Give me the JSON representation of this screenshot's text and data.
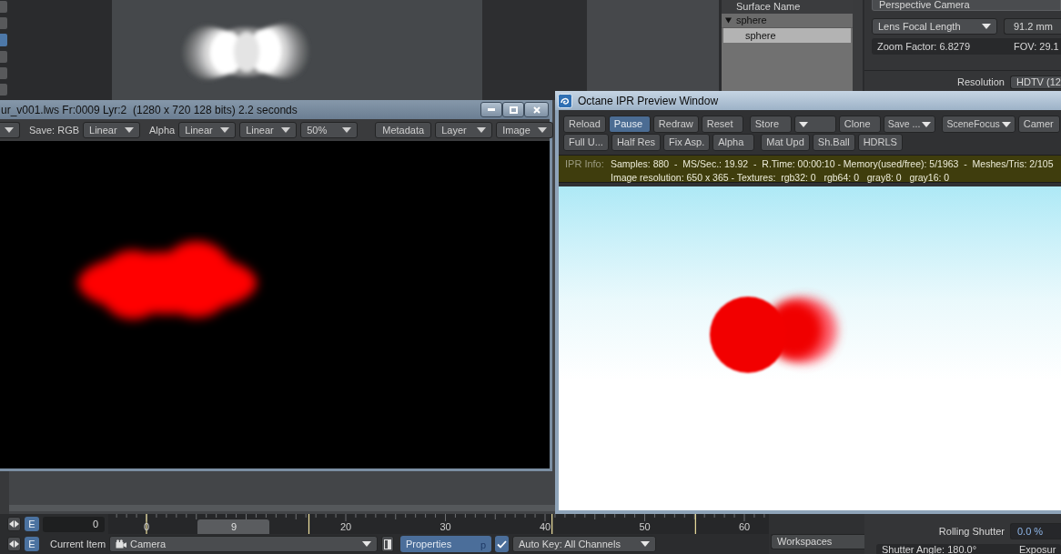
{
  "tool_strip": [
    {
      "selected": false
    },
    {
      "selected": false
    },
    {
      "selected": true
    },
    {
      "selected": false
    },
    {
      "selected": false
    },
    {
      "selected": false
    }
  ],
  "surface_panel": {
    "header": "Surface Name",
    "tree": [
      {
        "label": "sphere",
        "expanded": true,
        "selected": false,
        "children": [
          {
            "label": "sphere",
            "selected": true
          }
        ]
      }
    ]
  },
  "camera_panel": {
    "camera_type": "Perspective Camera",
    "lens_mode": "Lens Focal Length",
    "focal_length": "91.2 mm",
    "zoom_factor": "Zoom Factor: 6.8279",
    "fov": "FOV: 29.1",
    "resolution_label": "Resolution",
    "resolution": "HDTV (12",
    "rolling_shutter_label": "Rolling Shutter",
    "rolling_shutter": "0.0 %",
    "shutter_angle": "Shutter Angle: 180.0°",
    "exposure": "Exposur"
  },
  "render_window": {
    "title": "ur_v001.lws Fr:0009 Lyr:2  (1280 x 720 128 bits) 2.2 seconds",
    "toolbar": [
      {
        "kind": "dropdown"
      },
      {
        "kind": "label",
        "text": "Save: RGB"
      },
      {
        "kind": "dropdown",
        "label": "Linear"
      },
      {
        "kind": "label",
        "text": "Alpha"
      },
      {
        "kind": "dropdown",
        "label": "Linear"
      },
      {
        "kind": "dropdown",
        "label": "Linear"
      },
      {
        "kind": "dropdown",
        "label": "50%"
      },
      {
        "kind": "button",
        "label": "Metadata"
      },
      {
        "kind": "dropdown",
        "label": "Layer"
      },
      {
        "kind": "dropdown",
        "label": "Image"
      }
    ]
  },
  "ipr_window": {
    "title": "Octane IPR Preview Window",
    "toolbar_rows": [
      [
        [
          {
            "kind": "button",
            "label": "Reload",
            "pressed": false
          },
          {
            "kind": "button",
            "label": "Pause",
            "pressed": true
          },
          {
            "kind": "button",
            "label": "Redraw",
            "pressed": false
          },
          {
            "kind": "button",
            "label": "Reset",
            "pressed": false
          }
        ],
        [
          {
            "kind": "button",
            "label": "Store",
            "pressed": false
          },
          {
            "kind": "dropdown",
            "pressed": false
          },
          {
            "kind": "button",
            "label": "Clone",
            "pressed": false
          },
          {
            "kind": "dropdown",
            "label": "Save ...",
            "pressed": false
          }
        ],
        [
          {
            "kind": "dropdown",
            "label": "SceneFocus",
            "pressed": false
          },
          {
            "kind": "button",
            "label": "Camer",
            "pressed": false
          }
        ]
      ],
      [
        [
          {
            "kind": "button",
            "label": "Full U...",
            "pressed": false
          },
          {
            "kind": "button",
            "label": "Half Res",
            "pressed": false
          },
          {
            "kind": "button",
            "label": "Fix Asp.",
            "pressed": false
          },
          {
            "kind": "button",
            "label": "Alpha",
            "pressed": false
          }
        ],
        [
          {
            "kind": "button",
            "label": "Mat Upd",
            "pressed": false
          },
          {
            "kind": "button",
            "label": "Sh.Ball",
            "pressed": false
          },
          {
            "kind": "button",
            "label": "HDRLS",
            "pressed": false
          }
        ]
      ]
    ],
    "info": {
      "label": "IPR Info:",
      "lines": [
        "Samples: 880  -  MS/Sec.: 19.92  -  R.Time: 00:00:10 - Memory(used/free): 5/1963  -  Meshes/Tris: 2/105",
        "Image resolution: 650 x 365 - Textures:  rgb32: 0   rgb64: 0   gray8: 0   gray16: 0"
      ]
    }
  },
  "timeline": {
    "edit_button": {
      "label": "E",
      "on": true
    },
    "frame": "0",
    "ruler_labels": [
      "0",
      "20",
      "30",
      "40",
      "50",
      "60"
    ],
    "playhead": {
      "label": "9",
      "level": 0.19
    }
  },
  "bottom_bar": {
    "edit_button": {
      "label": "E",
      "on": true
    },
    "current_item_label": "Current Item",
    "current_item": "Camera",
    "properties": {
      "label": "Properties",
      "shortcut": "p"
    },
    "auto_key": {
      "checked": true,
      "label": "Auto Key: All Channels"
    }
  },
  "workspaces": "Workspaces"
}
